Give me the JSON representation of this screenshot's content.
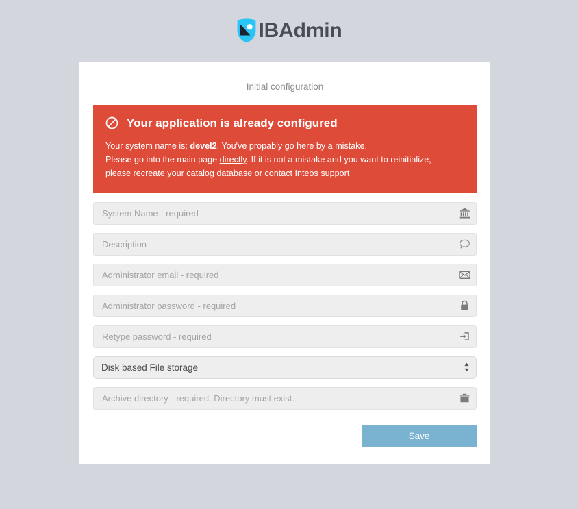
{
  "brand": {
    "name": "IBAdmin",
    "logo_icon": "shield-photo-logo-icon",
    "logo_color": "#29c5f6",
    "text_color": "#494e54"
  },
  "card": {
    "title": "Initial configuration"
  },
  "alert": {
    "icon": "ban-icon",
    "background_color": "#de4c39",
    "heading": "Your application is already configured",
    "line1_prefix": "Your system name is: ",
    "system_name": "devel2",
    "line1_suffix": ". You've propably go here by a mistake.",
    "line2_prefix": "Please go into the main page ",
    "link_directly": "directly",
    "line2_suffix": ". If it is not a mistake and you want to reinitialize,",
    "line3_prefix": "please recreate your catalog database or contact ",
    "link_support": "Inteos support"
  },
  "form": {
    "fields": [
      {
        "name": "system-name",
        "placeholder": "System Name - required",
        "value": "",
        "type": "text",
        "icon": "bank-icon"
      },
      {
        "name": "description",
        "placeholder": "Description",
        "value": "",
        "type": "text",
        "icon": "comment-icon"
      },
      {
        "name": "administrator-email",
        "placeholder": "Administrator email - required",
        "value": "",
        "type": "text",
        "icon": "envelope-icon"
      },
      {
        "name": "administrator-password",
        "placeholder": "Administrator password - required",
        "value": "",
        "type": "password",
        "icon": "lock-icon"
      },
      {
        "name": "retype-password",
        "placeholder": "Retype password - required",
        "value": "",
        "type": "password",
        "icon": "sign-in-icon"
      }
    ],
    "storage_select": {
      "selected": "Disk based File storage",
      "options": [
        "Disk based File storage"
      ],
      "icon": "sort-updown-icon"
    },
    "archive_field": {
      "placeholder": "Archive directory - required. Directory must exist.",
      "value": "",
      "icon": "archive-icon"
    },
    "save_label": "Save",
    "save_color": "#7ab2d1"
  }
}
